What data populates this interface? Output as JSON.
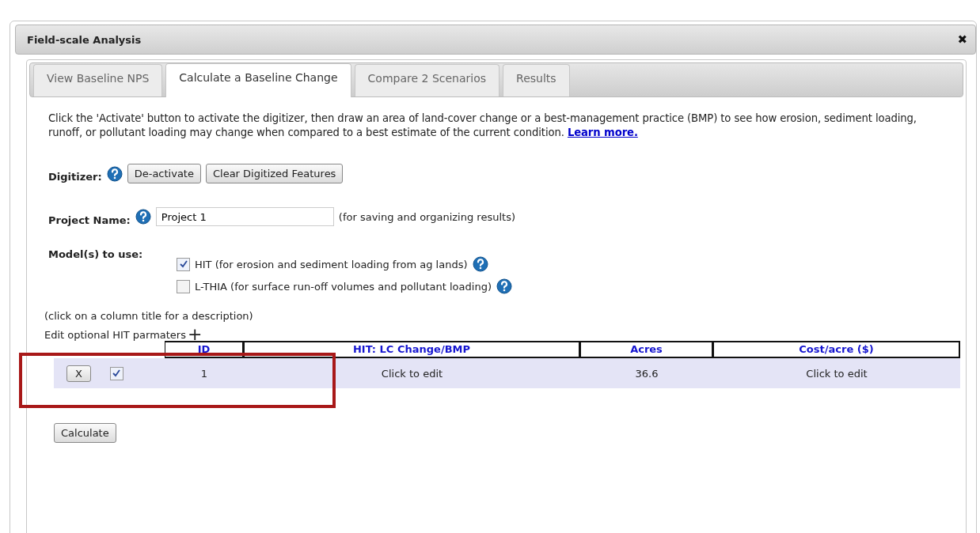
{
  "window": {
    "title": "Field-scale Analysis",
    "close": "✖"
  },
  "tabs": [
    {
      "label": "View Baseline NPS",
      "selected": false
    },
    {
      "label": "Calculate a Baseline Change",
      "selected": true
    },
    {
      "label": "Compare 2 Scenarios",
      "selected": false
    },
    {
      "label": "Results",
      "selected": false
    }
  ],
  "intro": {
    "text": "Click the 'Activate' button to activate the digitizer, then draw an area of land-cover change or a best-management practice (BMP) to see how erosion, sediment loading, runoff, or pollutant loading may change when compared to a best estimate of the current condition.",
    "link": "Learn more."
  },
  "digitizer": {
    "label": "Digitizer:",
    "buttons": [
      "De-activate",
      "Clear Digitized Features"
    ]
  },
  "project": {
    "label": "Project Name:",
    "value": "Project 1",
    "note": "(for saving and organizing results)"
  },
  "models": {
    "label": "Model(s) to use:",
    "items": [
      {
        "label": "HIT (for erosion and sediment loading from ag lands)",
        "checked": true
      },
      {
        "label": "L-THIA (for surface run-off volumes and pollutant loading)",
        "checked": false
      }
    ]
  },
  "hint": "(click on a column title for a description)",
  "optional": {
    "label": "Edit optional HIT parmaters",
    "toggle": "+"
  },
  "table": {
    "columns": [
      "ID",
      "HIT: LC Change/BMP",
      "Acres",
      "Cost/acre ($)"
    ],
    "rows": [
      {
        "remove": "X",
        "checked": true,
        "cells": [
          "1",
          "Click to edit",
          "36.6",
          "Click to edit"
        ]
      }
    ]
  },
  "calculate": "Calculate"
}
